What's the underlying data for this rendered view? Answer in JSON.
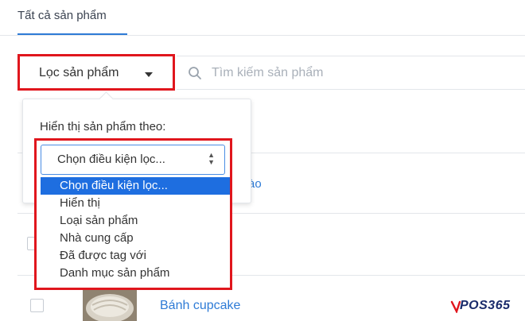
{
  "tabs": [
    {
      "label": "Tất cả sản phẩm",
      "active": true
    }
  ],
  "filter": {
    "label": "Lọc sản phẩm"
  },
  "search": {
    "placeholder": "Tìm kiếm sản phẩm"
  },
  "panel": {
    "title": "Hiển thị sản phẩm theo:",
    "select": {
      "value": "Chọn điều kiện lọc...",
      "options": [
        "Chọn điều kiện lọc...",
        "Hiển thị",
        "Loại sản phẩm",
        "Nhà cung cấp",
        "Đã được tag với",
        "Danh mục sản phẩm"
      ],
      "selected_index": 0
    }
  },
  "background": {
    "link_fragment": "ào"
  },
  "products": [
    {
      "name": "Bánh cupcake"
    }
  ],
  "logo": {
    "text": "POS365"
  },
  "colors": {
    "accent": "#2e7bd6",
    "highlight_border": "#e0161d",
    "option_selected": "#1e6ee0"
  }
}
